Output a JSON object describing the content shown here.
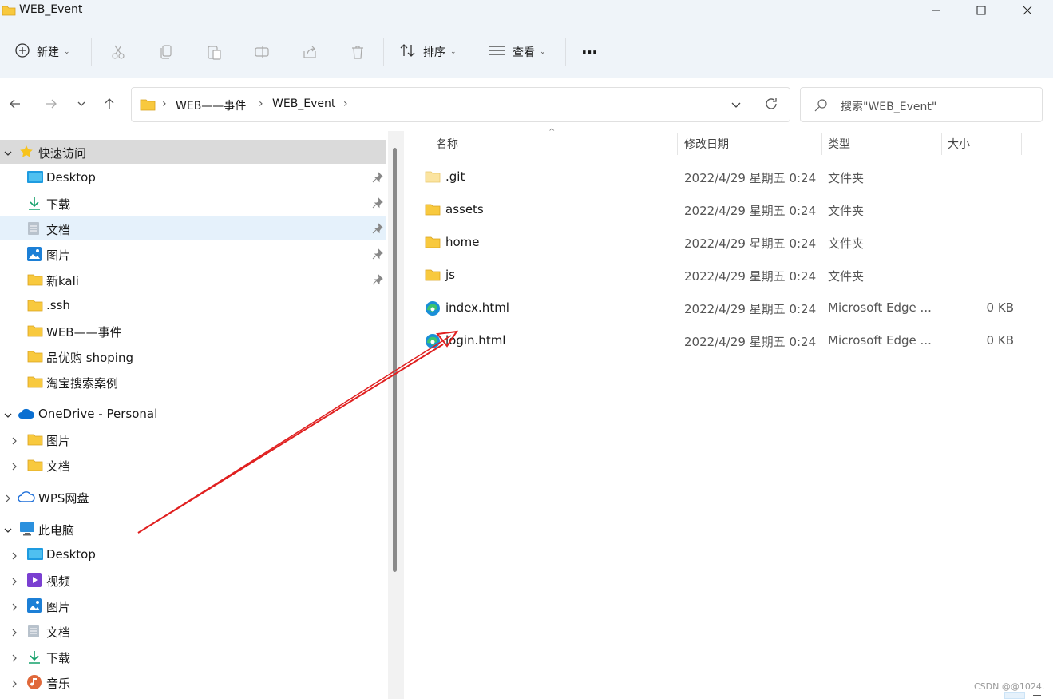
{
  "window": {
    "title": "WEB_Event"
  },
  "toolbar": {
    "new_label": "新建",
    "sort_label": "排序",
    "view_label": "查看",
    "more_label": "···"
  },
  "address": {
    "crumbs": [
      "WEB——事件",
      "WEB_Event"
    ]
  },
  "search": {
    "placeholder": "搜索\"WEB_Event\""
  },
  "nav": {
    "quick_access": {
      "label": "快速访问",
      "items": [
        {
          "label": "Desktop",
          "icon": "desktop-icon",
          "pinned": true
        },
        {
          "label": "下载",
          "icon": "download-icon",
          "pinned": true
        },
        {
          "label": "文档",
          "icon": "document-icon",
          "pinned": true,
          "selected": true
        },
        {
          "label": "图片",
          "icon": "pictures-icon",
          "pinned": true
        },
        {
          "label": "新kali",
          "icon": "folder-icon",
          "pinned": true
        },
        {
          "label": ".ssh",
          "icon": "folder-icon"
        },
        {
          "label": "WEB——事件",
          "icon": "folder-icon"
        },
        {
          "label": "品优购 shoping",
          "icon": "folder-icon"
        },
        {
          "label": "淘宝搜索案例",
          "icon": "folder-icon"
        }
      ]
    },
    "onedrive": {
      "label": "OneDrive - Personal",
      "items": [
        {
          "label": "图片",
          "icon": "folder-icon"
        },
        {
          "label": "文档",
          "icon": "folder-icon"
        }
      ]
    },
    "wps": {
      "label": "WPS网盘"
    },
    "this_pc": {
      "label": "此电脑",
      "items": [
        {
          "label": "Desktop",
          "icon": "desktop-icon"
        },
        {
          "label": "视频",
          "icon": "video-icon"
        },
        {
          "label": "图片",
          "icon": "pictures-icon"
        },
        {
          "label": "文档",
          "icon": "document-icon"
        },
        {
          "label": "下载",
          "icon": "download-icon"
        },
        {
          "label": "音乐",
          "icon": "music-icon"
        }
      ]
    }
  },
  "columns": {
    "name": "名称",
    "date": "修改日期",
    "type": "类型",
    "size": "大小"
  },
  "files": [
    {
      "name": ".git",
      "date": "2022/4/29 星期五 0:24",
      "type": "文件夹",
      "size": "",
      "icon": "folder-icon"
    },
    {
      "name": "assets",
      "date": "2022/4/29 星期五 0:24",
      "type": "文件夹",
      "size": "",
      "icon": "folder-icon"
    },
    {
      "name": "home",
      "date": "2022/4/29 星期五 0:24",
      "type": "文件夹",
      "size": "",
      "icon": "folder-icon"
    },
    {
      "name": "js",
      "date": "2022/4/29 星期五 0:24",
      "type": "文件夹",
      "size": "",
      "icon": "folder-icon"
    },
    {
      "name": "index.html",
      "date": "2022/4/29 星期五 0:24",
      "type": "Microsoft Edge ...",
      "size": "0 KB",
      "icon": "edge-icon"
    },
    {
      "name": "login.html",
      "date": "2022/4/29 星期五 0:24",
      "type": "Microsoft Edge ...",
      "size": "0 KB",
      "icon": "edge-icon"
    }
  ],
  "watermark": "CSDN @@1024.",
  "colors": {
    "accent": "#0067c0",
    "folder": "#f8c93e",
    "annotation": "#e02020",
    "selected": "#e5f1fb"
  }
}
